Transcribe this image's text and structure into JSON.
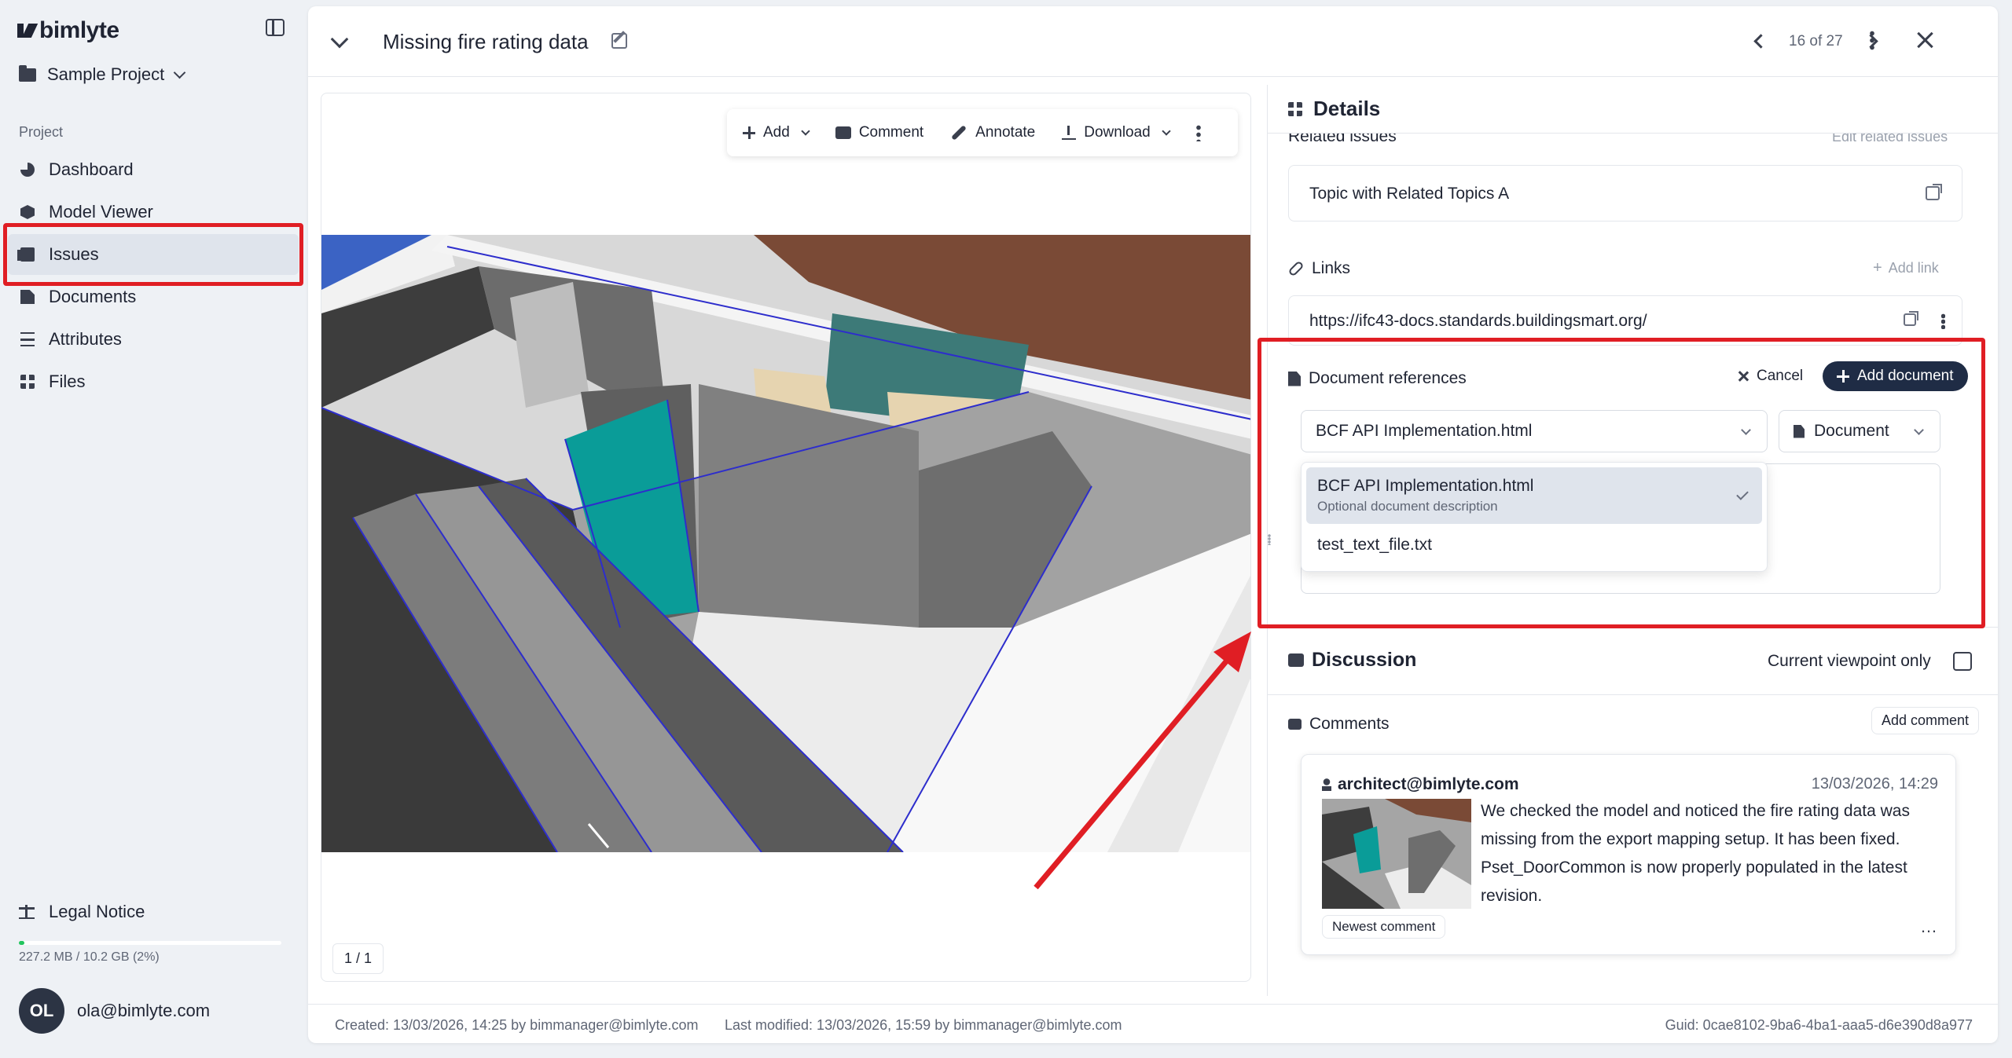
{
  "app": {
    "logo": "bimlyte"
  },
  "sidebar": {
    "project": "Sample Project",
    "section_label": "Project",
    "items": [
      {
        "label": "Dashboard",
        "icon": "dashboard-icon"
      },
      {
        "label": "Model Viewer",
        "icon": "cube-icon"
      },
      {
        "label": "Issues",
        "icon": "issues-icon",
        "active": true
      },
      {
        "label": "Documents",
        "icon": "document-icon"
      },
      {
        "label": "Attributes",
        "icon": "sliders-icon"
      },
      {
        "label": "Files",
        "icon": "grid-icon"
      }
    ],
    "legal": "Legal Notice",
    "storage": {
      "text": "227.2 MB / 10.2 GB (2%)",
      "fraction": 0.02
    },
    "user": {
      "initials": "OL",
      "email": "ola@bimlyte.com"
    }
  },
  "issue": {
    "title": "Missing fire rating data",
    "pager": "16 of 27"
  },
  "toolbar": {
    "add": "Add",
    "comment": "Comment",
    "annotate": "Annotate",
    "download": "Download"
  },
  "viewer": {
    "page": "1 / 1"
  },
  "details": {
    "title": "Details",
    "related_title": "Related issues",
    "related_action": "Edit related issues",
    "related_item": "Topic with Related Topics A",
    "links_title": "Links",
    "links_action": "Add link",
    "link_url": "https://ifc43-docs.standards.buildingsmart.org/",
    "docref_title": "Document references",
    "cancel": "Cancel",
    "add_document": "Add document",
    "doc_select": "BCF API Implementation.html",
    "type_select": "Document",
    "dropdown": [
      {
        "name": "BCF API Implementation.html",
        "desc": "Optional document description",
        "selected": true
      },
      {
        "name": "test_text_file.txt",
        "desc": "",
        "selected": false
      }
    ]
  },
  "discussion": {
    "title": "Discussion",
    "viewpoint_only": "Current viewpoint only",
    "comments_title": "Comments",
    "add_comment": "Add comment",
    "comment": {
      "author": "architect@bimlyte.com",
      "date": "13/03/2026, 14:29",
      "lines": [
        "We checked the model and noticed the fire rating data was",
        "missing from the export mapping setup. It has been fixed.",
        "Pset_DoorCommon is now properly populated in the latest",
        "revision."
      ],
      "badge": "Newest comment"
    }
  },
  "footer": {
    "created": "Created: 13/03/2026, 14:25 by bimmanager@bimlyte.com",
    "modified": "Last modified: 13/03/2026, 15:59 by bimmanager@bimlyte.com",
    "guid": "Guid: 0cae8102-9ba6-4ba1-aaa5-d6e390d8a977"
  },
  "colors": {
    "accent": "#1f2c45",
    "highlight": "#e01e24",
    "teal_door": "#0a9c98"
  }
}
